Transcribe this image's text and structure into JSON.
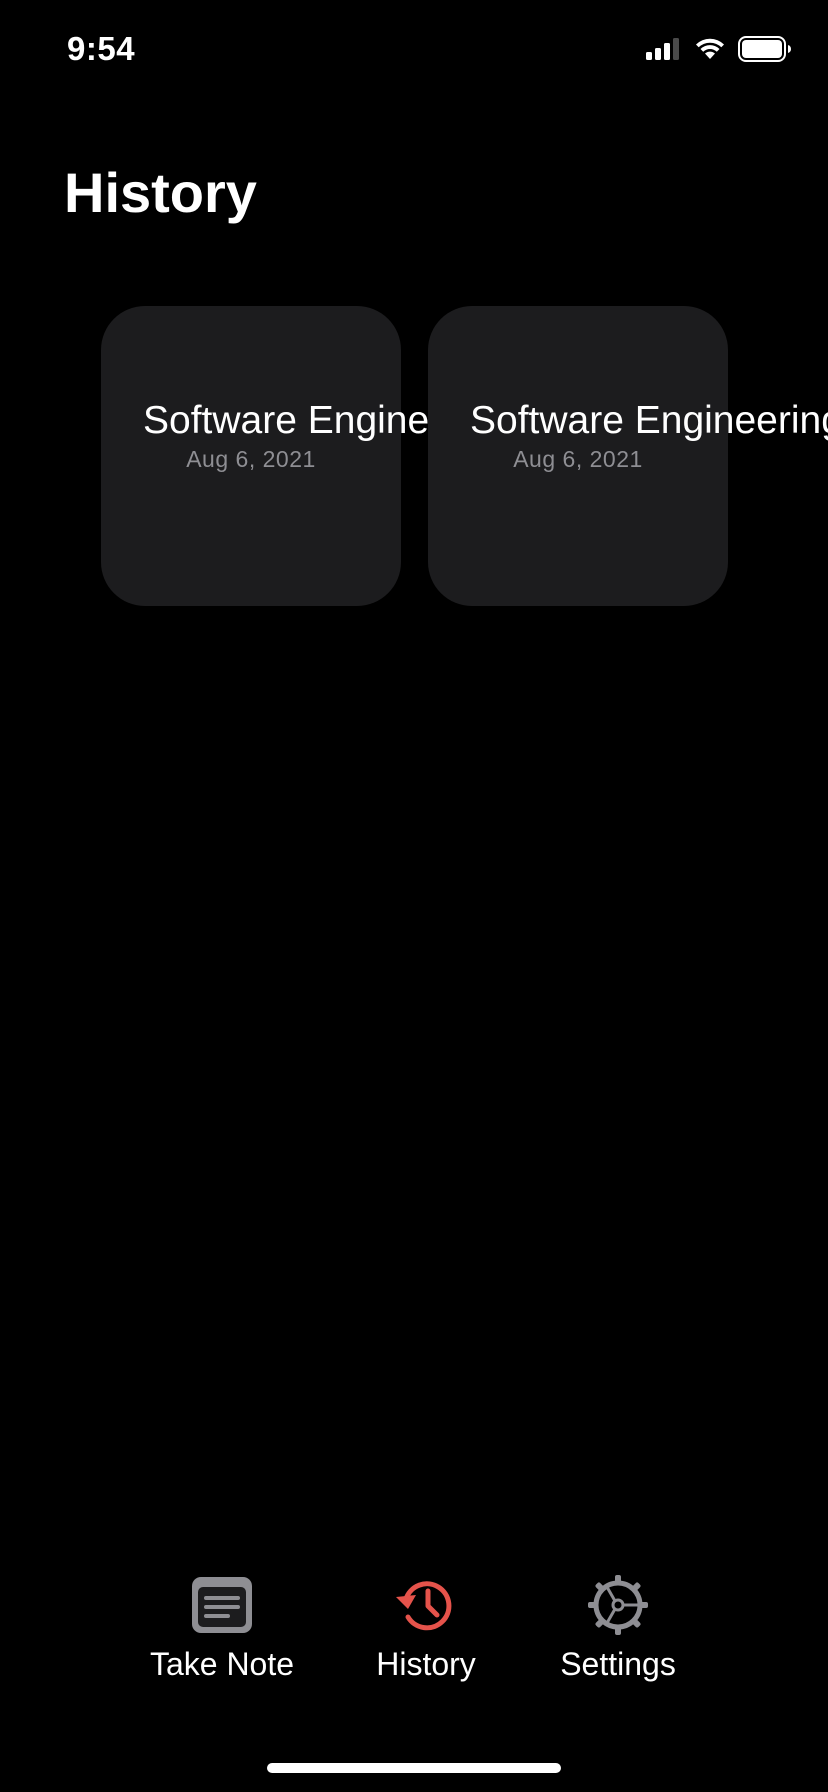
{
  "status_bar": {
    "time": "9:54",
    "icons": [
      "cellular-signal-icon",
      "wifi-icon",
      "battery-icon"
    ]
  },
  "page": {
    "title": "History"
  },
  "notes": [
    {
      "title": "Software Engineering",
      "date": "Aug 6, 2021"
    },
    {
      "title": "Software Engineering",
      "date": "Aug 6, 2021"
    }
  ],
  "tab_bar": {
    "active_color": "#e5534b",
    "inactive_color": "#8e8e93",
    "tabs": [
      {
        "label": "Take Note",
        "icon": "note-icon",
        "active": false
      },
      {
        "label": "History",
        "icon": "history-icon",
        "active": true
      },
      {
        "label": "Settings",
        "icon": "gear-icon",
        "active": false
      }
    ]
  }
}
